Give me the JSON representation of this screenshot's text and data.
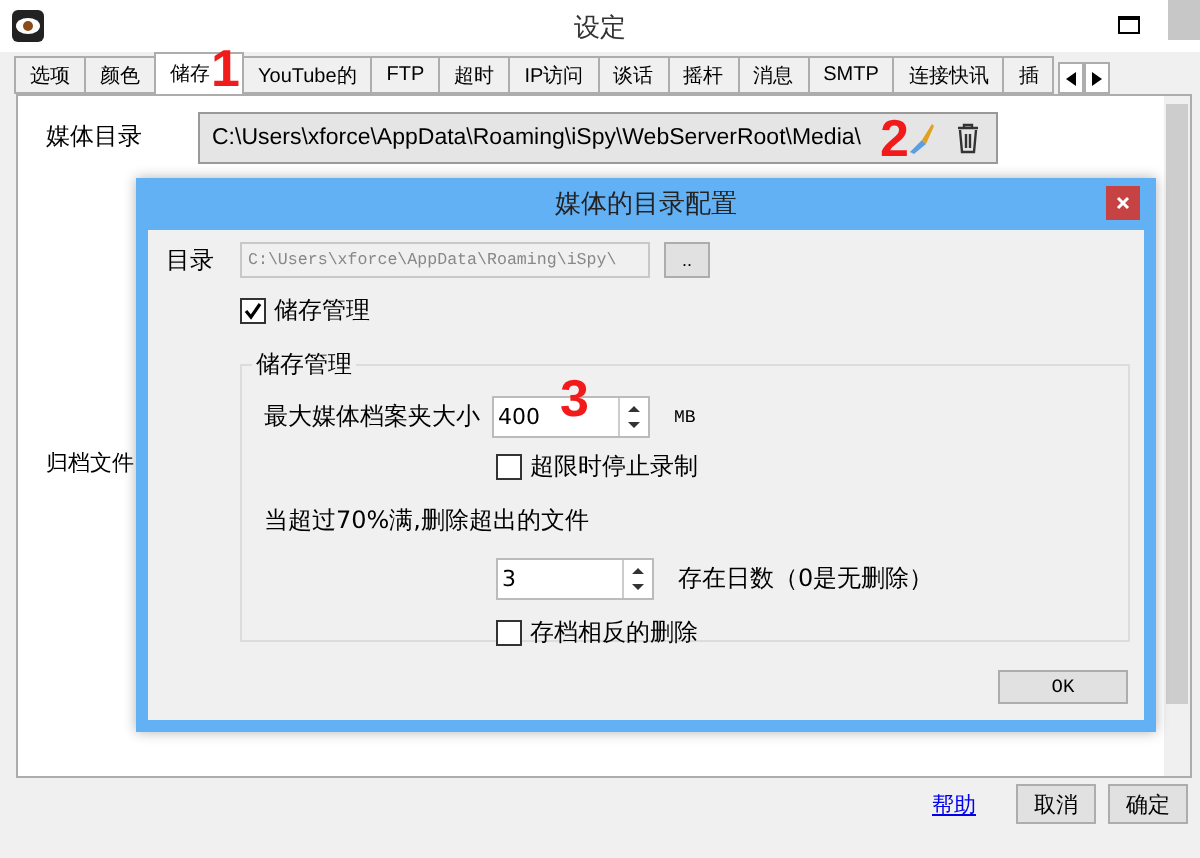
{
  "window": {
    "title": "设定"
  },
  "tabs": [
    {
      "label": "选项",
      "selected": false
    },
    {
      "label": "颜色",
      "selected": false
    },
    {
      "label": "储存",
      "selected": true
    },
    {
      "label": "YouTube的",
      "selected": false
    },
    {
      "label": "FTP",
      "selected": false
    },
    {
      "label": "超时",
      "selected": false
    },
    {
      "label": "IP访问",
      "selected": false
    },
    {
      "label": "谈话",
      "selected": false
    },
    {
      "label": "摇杆",
      "selected": false
    },
    {
      "label": "消息",
      "selected": false
    },
    {
      "label": "SMTP",
      "selected": false
    },
    {
      "label": "连接快讯",
      "selected": false
    },
    {
      "label": "插",
      "selected": false
    }
  ],
  "media_dir": {
    "label": "媒体目录",
    "path": "C:\\Users\\xforce\\AppData\\Roaming\\iSpy\\WebServerRoot\\Media\\"
  },
  "archive_label": "归档文件",
  "footer": {
    "help": "帮助",
    "buttons": [
      "取消",
      "确定"
    ]
  },
  "dialog": {
    "title": "媒体的目录配置",
    "dir_label": "目录",
    "dir_value": "C:\\Users\\xforce\\AppData\\Roaming\\iSpy\\",
    "browse": "..",
    "manage": {
      "label": "储存管理",
      "checked": true
    },
    "group_title": "储存管理",
    "max_size": {
      "label": "最大媒体档案夹大小",
      "value": "400",
      "unit": "MB"
    },
    "stop": {
      "label": "超限时停止录制",
      "checked": false
    },
    "threshold": "当超过70%满,删除超出的文件",
    "days": {
      "value": "3",
      "label": "存在日数（0是无删除）"
    },
    "archive": {
      "label": "存档相反的删除",
      "checked": false
    },
    "ok": "OK"
  },
  "annotations": [
    "1",
    "2",
    "3"
  ]
}
